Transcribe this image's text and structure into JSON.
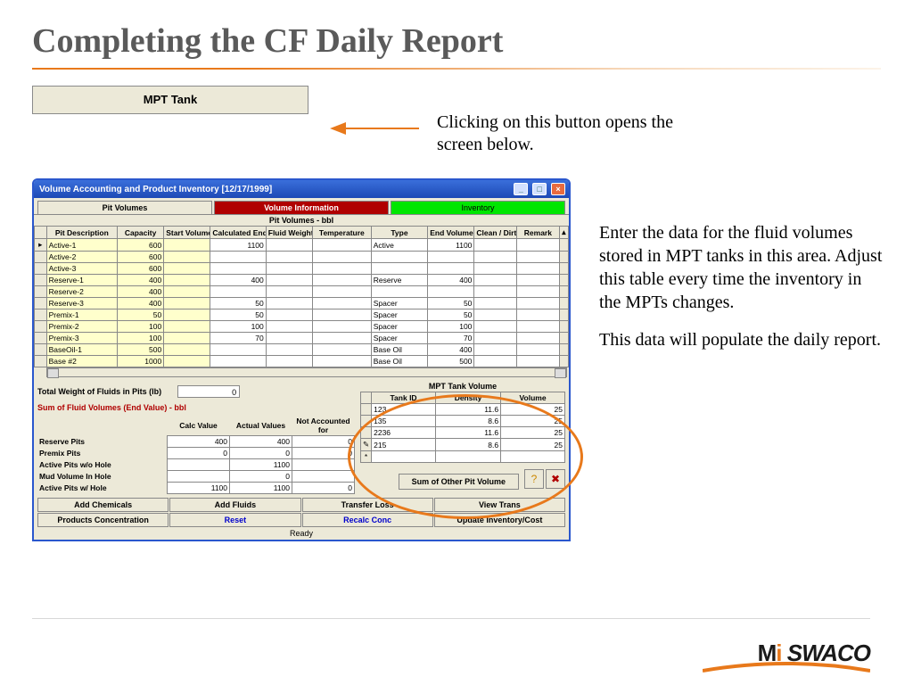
{
  "slide_title": "Completing the CF Daily Report",
  "mpt_button_label": "MPT Tank",
  "callout_top": "Clicking on this button opens the screen below.",
  "callout_side_1": "Enter the data for the fluid volumes stored in MPT tanks in this area. Adjust this table every time the inventory in the MPTs changes.",
  "callout_side_2": "This data will populate the daily report.",
  "window": {
    "title": "Volume Accounting and Product Inventory [12/17/1999]",
    "tabs": {
      "pit": "Pit Volumes",
      "vol": "Volume Information",
      "inv": "Inventory"
    },
    "pit_head": "Pit Volumes - bbl",
    "columns": {
      "desc": "Pit Description",
      "cap": "Capacity",
      "start": "Start Volume",
      "calc": "Calculated End Vol.",
      "fw": "Fluid Weight",
      "temp": "Temperature",
      "type": "Type",
      "end": "End Volume",
      "clean": "Clean / Dirty",
      "rem": "Remark"
    },
    "rows": [
      {
        "desc": "Active-1",
        "cap": "600",
        "start": "",
        "calc": "1100",
        "fw": "",
        "temp": "",
        "type": "Active",
        "end": "1100",
        "clean": "",
        "rem": ""
      },
      {
        "desc": "Active-2",
        "cap": "600",
        "start": "",
        "calc": "",
        "fw": "",
        "temp": "",
        "type": "",
        "end": "",
        "clean": "",
        "rem": ""
      },
      {
        "desc": "Active-3",
        "cap": "600",
        "start": "",
        "calc": "",
        "fw": "",
        "temp": "",
        "type": "",
        "end": "",
        "clean": "",
        "rem": ""
      },
      {
        "desc": "Reserve-1",
        "cap": "400",
        "start": "",
        "calc": "400",
        "fw": "",
        "temp": "",
        "type": "Reserve",
        "end": "400",
        "clean": "",
        "rem": ""
      },
      {
        "desc": "Reserve-2",
        "cap": "400",
        "start": "",
        "calc": "",
        "fw": "",
        "temp": "",
        "type": "",
        "end": "",
        "clean": "",
        "rem": ""
      },
      {
        "desc": "Reserve-3",
        "cap": "400",
        "start": "",
        "calc": "50",
        "fw": "",
        "temp": "",
        "type": "Spacer",
        "end": "50",
        "clean": "",
        "rem": ""
      },
      {
        "desc": "Premix-1",
        "cap": "50",
        "start": "",
        "calc": "50",
        "fw": "",
        "temp": "",
        "type": "Spacer",
        "end": "50",
        "clean": "",
        "rem": ""
      },
      {
        "desc": "Premix-2",
        "cap": "100",
        "start": "",
        "calc": "100",
        "fw": "",
        "temp": "",
        "type": "Spacer",
        "end": "100",
        "clean": "",
        "rem": ""
      },
      {
        "desc": "Premix-3",
        "cap": "100",
        "start": "",
        "calc": "70",
        "fw": "",
        "temp": "",
        "type": "Spacer",
        "end": "70",
        "clean": "",
        "rem": ""
      },
      {
        "desc": "BaseOil-1",
        "cap": "500",
        "start": "",
        "calc": "",
        "fw": "",
        "temp": "",
        "type": "Base Oil",
        "end": "400",
        "clean": "",
        "rem": ""
      },
      {
        "desc": "Base #2",
        "cap": "1000",
        "start": "",
        "calc": "",
        "fw": "",
        "temp": "",
        "type": "Base Oil",
        "end": "500",
        "clean": "",
        "rem": ""
      }
    ],
    "total_weight_label": "Total Weight of Fluids in Pits (lb)",
    "total_weight_value": "0",
    "sum_label": "Sum of Fluid Volumes (End Value) - bbl",
    "sum_cols": {
      "calc": "Calc Value",
      "act": "Actual Values",
      "na": "Not Accounted for"
    },
    "sum_rows": [
      {
        "lab": "Reserve Pits",
        "calc": "400",
        "act": "400",
        "na": "0"
      },
      {
        "lab": "Premix Pits",
        "calc": "0",
        "act": "0",
        "na": "0"
      },
      {
        "lab": "Active Pits w/o Hole",
        "calc": "",
        "act": "1100",
        "na": ""
      },
      {
        "lab": "Mud Volume In Hole",
        "calc": "",
        "act": "0",
        "na": ""
      },
      {
        "lab": "Active Pits w/ Hole",
        "calc": "1100",
        "act": "1100",
        "na": "0"
      }
    ],
    "mpt_title": "MPT Tank Volume",
    "mpt_cols": {
      "id": "Tank ID",
      "den": "Density",
      "vol": "Volume"
    },
    "mpt_rows": [
      {
        "id": "123",
        "den": "11.6",
        "vol": "25"
      },
      {
        "id": "135",
        "den": "8.6",
        "vol": "25"
      },
      {
        "id": "2236",
        "den": "11.6",
        "vol": "25"
      },
      {
        "id": "215",
        "den": "8.6",
        "vol": "25"
      }
    ],
    "sum_btn": "Sum of Other Pit Volume",
    "btns1": {
      "a": "Add Chemicals",
      "b": "Add Fluids",
      "c": "Transfer Loss",
      "d": "View Trans"
    },
    "btns2": {
      "a": "Products Concentration",
      "b": "Reset",
      "c": "Recalc Conc",
      "d": "Update Inventory/Cost"
    },
    "status": "Ready",
    "help_icon": "?",
    "exit_icon": "✖"
  },
  "logo_text": "Mi SWACO"
}
